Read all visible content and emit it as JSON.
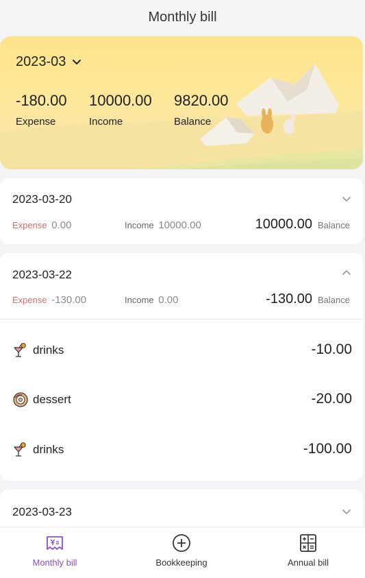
{
  "header": {
    "title": "Monthly bill"
  },
  "summary": {
    "month": "2023-03",
    "expense_value": "-180.00",
    "expense_label": "Expense",
    "income_value": "10000.00",
    "income_label": "Income",
    "balance_value": "9820.00",
    "balance_label": "Balance"
  },
  "days": [
    {
      "date": "2023-03-20",
      "expanded": false,
      "expense_label": "Expense",
      "expense_value": "0.00",
      "income_label": "Income",
      "income_value": "10000.00",
      "balance_value": "10000.00",
      "balance_label": "Balance",
      "items": []
    },
    {
      "date": "2023-03-22",
      "expanded": true,
      "expense_label": "Expense",
      "expense_value": "-130.00",
      "income_label": "Income",
      "income_value": "0.00",
      "balance_value": "-130.00",
      "balance_label": "Balance",
      "items": [
        {
          "icon": "drinks-icon",
          "name": "drinks",
          "amount": "-10.00"
        },
        {
          "icon": "dessert-icon",
          "name": "dessert",
          "amount": "-20.00"
        },
        {
          "icon": "drinks-icon",
          "name": "drinks",
          "amount": "-100.00"
        }
      ]
    },
    {
      "date": "2023-03-23",
      "expanded": false
    }
  ],
  "tabbar": {
    "tabs": [
      {
        "label": "Monthly bill",
        "icon": "monthly-bill-icon",
        "active": true
      },
      {
        "label": "Bookkeeping",
        "icon": "plus-circle-icon",
        "active": false
      },
      {
        "label": "Annual bill",
        "icon": "calculator-icon",
        "active": false
      }
    ]
  },
  "colors": {
    "accent": "#8a4fd0",
    "expense": "#e16a6a",
    "banner": "#fde48a"
  }
}
